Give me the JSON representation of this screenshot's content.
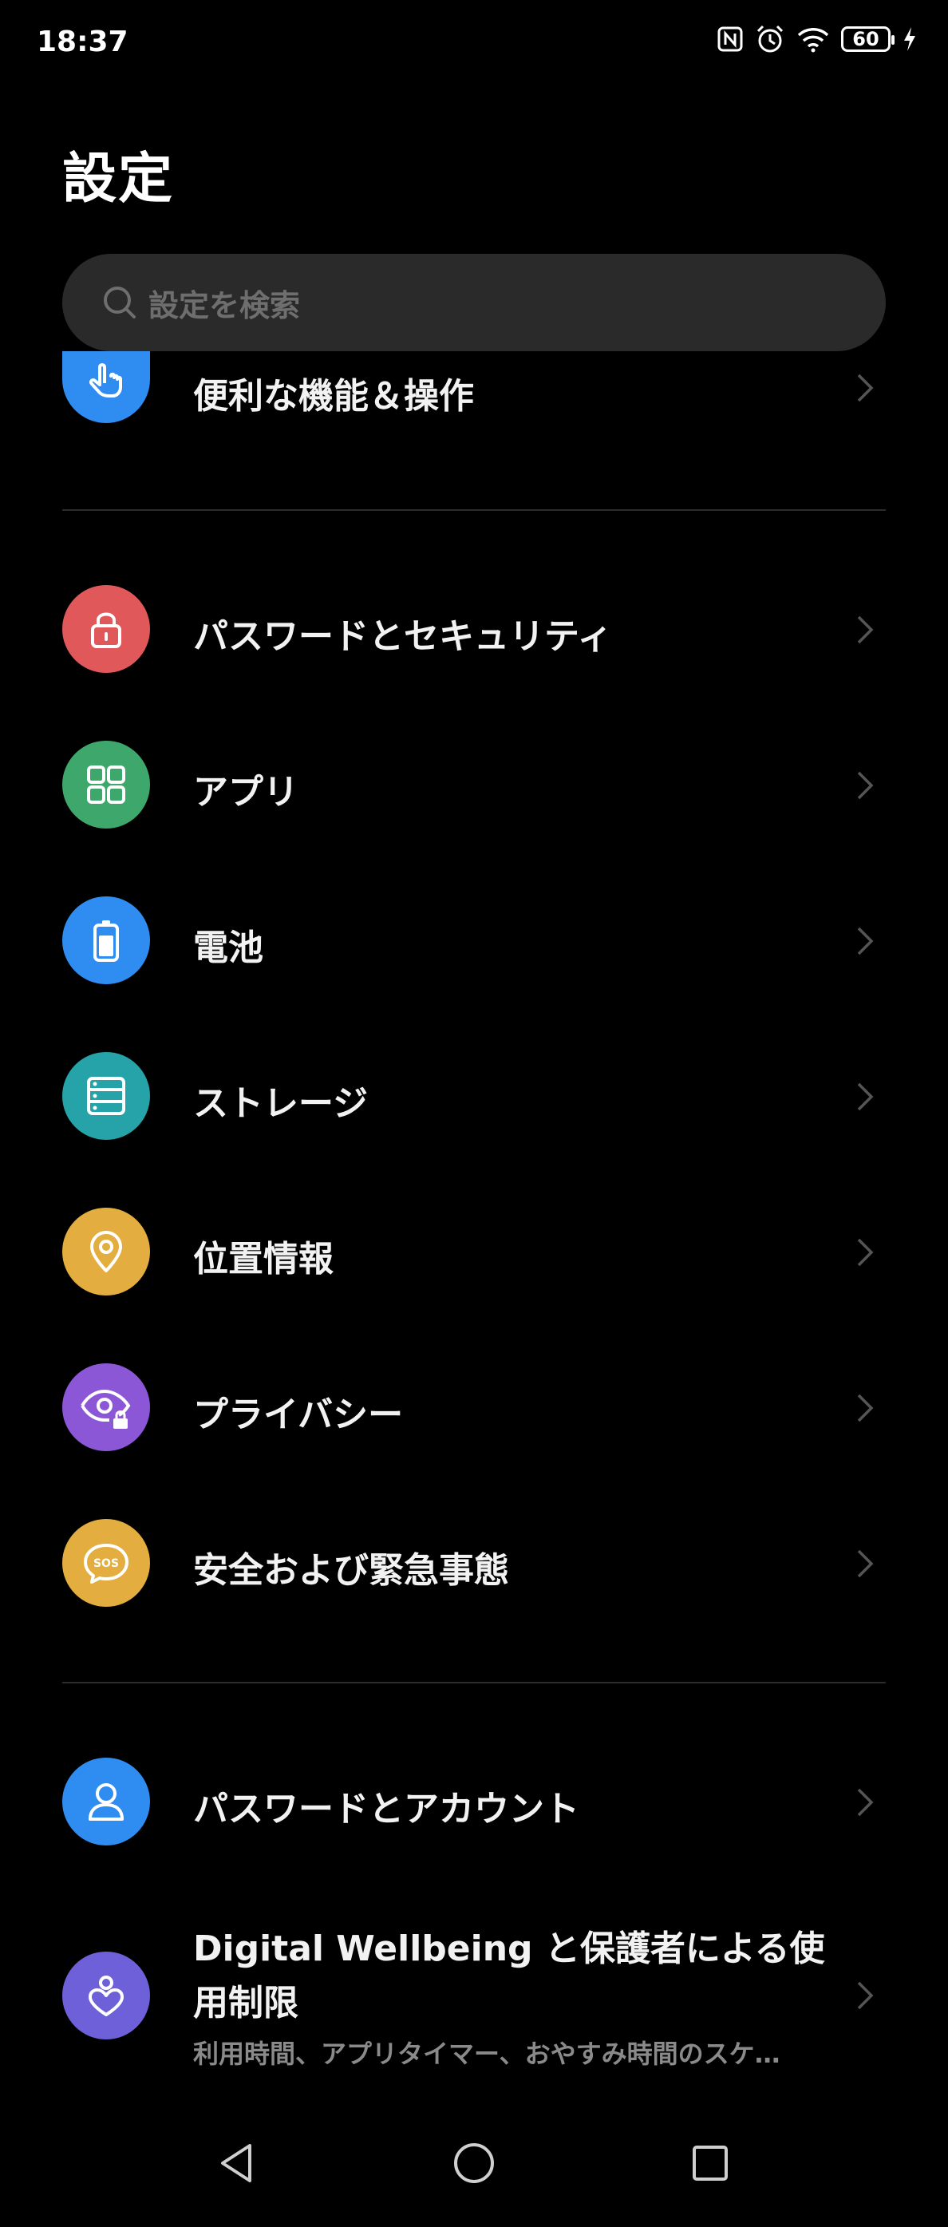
{
  "status": {
    "time": "18:37",
    "battery": "60",
    "icons": [
      "nfc-icon",
      "alarm-icon",
      "wifi-icon",
      "battery-icon",
      "charging-icon"
    ]
  },
  "page": {
    "title": "設定"
  },
  "search": {
    "placeholder": "設定を検索"
  },
  "items": [
    {
      "label": "便利な機能＆操作",
      "icon": "hand-tap-icon",
      "color": "#2f8cf0"
    },
    {
      "label": "パスワードとセキュリティ",
      "icon": "lock-icon",
      "color": "#e0585a"
    },
    {
      "label": "アプリ",
      "icon": "apps-grid-icon",
      "color": "#3ea86c"
    },
    {
      "label": "電池",
      "icon": "battery-icon",
      "color": "#2f8cf0"
    },
    {
      "label": "ストレージ",
      "icon": "storage-icon",
      "color": "#26a3a8"
    },
    {
      "label": "位置情報",
      "icon": "location-pin-icon",
      "color": "#e3ad3f"
    },
    {
      "label": "プライバシー",
      "icon": "privacy-eye-icon",
      "color": "#8b57d6"
    },
    {
      "label": "安全および緊急事態",
      "icon": "sos-icon",
      "color": "#e3ad3f"
    },
    {
      "label": "パスワードとアカウント",
      "icon": "person-icon",
      "color": "#2f8cf0"
    }
  ],
  "wellbeing": {
    "title": "Digital Wellbeing と保護者による使用制限",
    "subtitle": "利用時間、アプリタイマー、おやすみ時間のスケ…",
    "icon": "wellbeing-heart-icon",
    "color": "#6d60d8"
  },
  "navbar": {
    "buttons": [
      "back-icon",
      "home-icon",
      "recents-icon"
    ]
  }
}
